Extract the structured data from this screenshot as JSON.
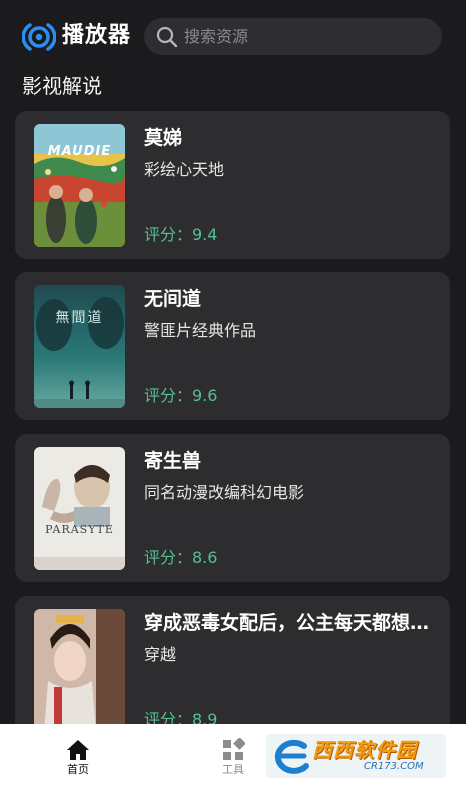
{
  "app": {
    "title": "播放器"
  },
  "search": {
    "placeholder": "搜索资源"
  },
  "section": {
    "title": "影视解说"
  },
  "items": [
    {
      "title": "莫娣",
      "desc": "彩绘心天地",
      "score": "评分：9.4",
      "poster_text": "MAUDIE"
    },
    {
      "title": "无间道",
      "desc": "警匪片经典作品",
      "score": "评分：9.6",
      "poster_text": "無間道"
    },
    {
      "title": "寄生兽",
      "desc": "同名动漫改编科幻电影",
      "score": "评分：8.6",
      "poster_text": "PARASYTE"
    },
    {
      "title": "穿成恶毒女配后，公主每天都想…",
      "desc": "穿越",
      "score": "评分：8.9",
      "poster_text": ""
    }
  ],
  "tabbar": {
    "home_label": "首页",
    "tools_label": "工具"
  },
  "watermark": {
    "text": "西西软件园",
    "url": "CR173.COM"
  },
  "colors": {
    "background": "#1b1b1d",
    "card": "#2d2d30",
    "accent": "#1e88e5",
    "score": "#55c08f"
  }
}
